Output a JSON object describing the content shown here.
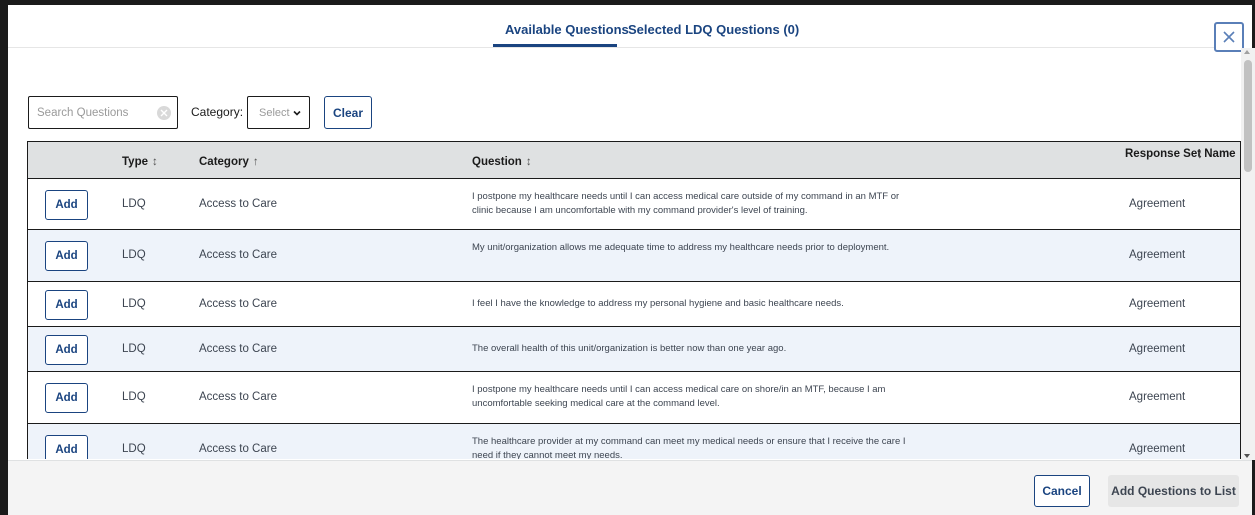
{
  "tabs": {
    "available": "Available Questions",
    "selected": "Selected LDQ Questions (0)"
  },
  "filters": {
    "search_placeholder": "Search Questions",
    "search_value": "",
    "category_label": "Category:",
    "category_select": "Select",
    "clear_label": "Clear"
  },
  "table": {
    "headers": {
      "type": "Type",
      "category": "Category",
      "question": "Question",
      "response_set": "Response Set Name"
    },
    "sort_icons": {
      "type": "↕",
      "category": "↑",
      "question": "↕",
      "response_set": "↕"
    },
    "add_label": "Add",
    "rows": [
      {
        "type": "LDQ",
        "category": "Access to Care",
        "question": "I postpone my healthcare needs until I can access medical care outside of my command in an MTF or clinic because I am uncomfortable with my command provider's level of training.",
        "response_set": "Agreement"
      },
      {
        "type": "LDQ",
        "category": "Access to Care",
        "question": "My unit/organization allows me adequate time to address my healthcare needs prior to deployment.",
        "response_set": "Agreement"
      },
      {
        "type": "LDQ",
        "category": "Access to Care",
        "question": "I feel I have the knowledge to address my personal hygiene and basic healthcare needs.",
        "response_set": "Agreement"
      },
      {
        "type": "LDQ",
        "category": "Access to Care",
        "question": "The overall health of this unit/organization is better now than one year ago.",
        "response_set": "Agreement"
      },
      {
        "type": "LDQ",
        "category": "Access to Care",
        "question": "I postpone my healthcare needs until I can access medical care on shore/in an MTF, because I am uncomfortable seeking medical care at the command level.",
        "response_set": "Agreement"
      },
      {
        "type": "LDQ",
        "category": "Access to Care",
        "question": "The healthcare provider at my command can meet my medical needs or ensure that I receive the care I need if they cannot meet my needs.",
        "response_set": "Agreement"
      }
    ]
  },
  "footer": {
    "cancel_label": "Cancel",
    "add_questions_label": "Add Questions to List"
  },
  "colors": {
    "accent": "#1a4480",
    "row_alt": "#eef3fa",
    "header_bg": "#dfe1e2",
    "footer_bg": "#f4f4f4"
  }
}
